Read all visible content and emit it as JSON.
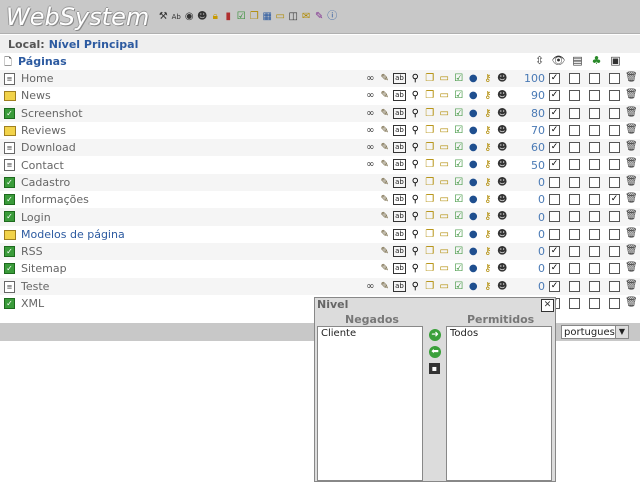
{
  "app": {
    "title": "WebSystem"
  },
  "toolbar": {
    "icons": [
      "tools-icon",
      "spell-icon",
      "target-icon",
      "users-icon",
      "lock-icon",
      "stats-icon",
      "approve-icon",
      "copy-icon",
      "table-icon",
      "folder-icon",
      "window-icon",
      "mail-icon",
      "edit-icon",
      "help-icon"
    ]
  },
  "location": {
    "label": "Local:",
    "value": "Nível Principal"
  },
  "pages_header": {
    "title": "Páginas",
    "column_icons": [
      "order-icon",
      "visible-icon",
      "cache-icon",
      "menu-icon",
      "save-icon"
    ]
  },
  "pages": [
    {
      "name": "Home",
      "icon": "doc",
      "link": false,
      "ops": true,
      "order": "100",
      "checks": [
        true,
        false,
        false,
        false
      ]
    },
    {
      "name": "News",
      "icon": "folder",
      "link": false,
      "ops": true,
      "order": "90",
      "checks": [
        true,
        false,
        false,
        false
      ]
    },
    {
      "name": "Screenshot",
      "icon": "check",
      "link": false,
      "ops": true,
      "order": "80",
      "checks": [
        true,
        false,
        false,
        false
      ]
    },
    {
      "name": "Reviews",
      "icon": "folder",
      "link": false,
      "ops": true,
      "order": "70",
      "checks": [
        true,
        false,
        false,
        false
      ]
    },
    {
      "name": "Download",
      "icon": "doc",
      "link": false,
      "ops": true,
      "order": "60",
      "checks": [
        true,
        false,
        false,
        false
      ]
    },
    {
      "name": "Contact",
      "icon": "doc",
      "link": false,
      "ops": true,
      "order": "50",
      "checks": [
        true,
        false,
        false,
        false
      ]
    },
    {
      "name": "Cadastro",
      "icon": "check",
      "link": false,
      "ops": false,
      "order": "0",
      "checks": [
        false,
        false,
        false,
        false
      ]
    },
    {
      "name": "Informações",
      "icon": "check",
      "link": false,
      "ops": false,
      "order": "0",
      "checks": [
        false,
        false,
        false,
        true
      ]
    },
    {
      "name": "Login",
      "icon": "check",
      "link": false,
      "ops": false,
      "order": "0",
      "checks": [
        false,
        false,
        false,
        false
      ]
    },
    {
      "name": "Modelos de página",
      "icon": "folder",
      "link": true,
      "ops": false,
      "order": "0",
      "checks": [
        false,
        false,
        false,
        false
      ]
    },
    {
      "name": "RSS",
      "icon": "check",
      "link": false,
      "ops": false,
      "order": "0",
      "checks": [
        true,
        false,
        false,
        false
      ]
    },
    {
      "name": "Sitemap",
      "icon": "check",
      "link": false,
      "ops": false,
      "order": "0",
      "checks": [
        true,
        false,
        false,
        false
      ]
    },
    {
      "name": "Teste",
      "icon": "doc",
      "link": false,
      "ops": true,
      "order": "0",
      "checks": [
        true,
        false,
        false,
        false
      ]
    },
    {
      "name": "XML",
      "icon": "check",
      "link": false,
      "ops": false,
      "order": "",
      "checks": [
        true,
        false,
        false,
        false
      ]
    }
  ],
  "row_action_icons": [
    "link-icon",
    "edit-icon",
    "rename-icon",
    "search-icon",
    "copy-icon",
    "move-icon",
    "approve-icon",
    "globe-icon",
    "key-icon",
    "users-icon"
  ],
  "language": {
    "selected": "portugues"
  },
  "nivel_dialog": {
    "title": "Nivel",
    "denied_header": "Negados",
    "allowed_header": "Permitidos",
    "denied_items": [
      "Cliente"
    ],
    "allowed_items": [
      "Todos"
    ]
  }
}
